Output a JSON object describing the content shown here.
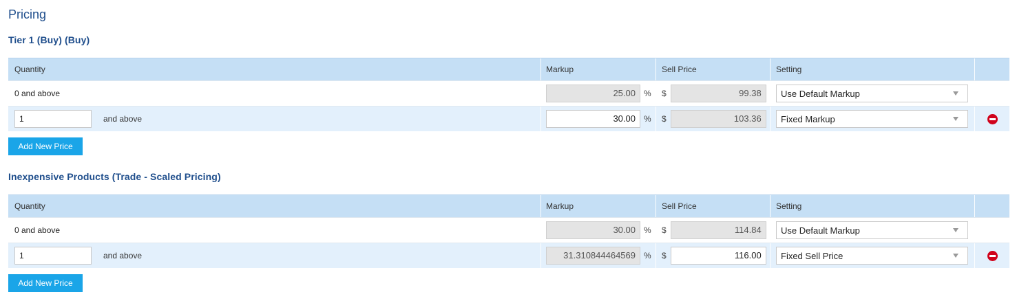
{
  "page": {
    "title": "Pricing"
  },
  "columns": {
    "quantity": "Quantity",
    "markup": "Markup",
    "sell_price": "Sell Price",
    "setting": "Setting"
  },
  "symbols": {
    "percent": "%",
    "dollar": "$"
  },
  "add_label": "Add New Price",
  "sections": [
    {
      "title": "Tier 1 (Buy) (Buy)",
      "rows": [
        {
          "quantity_text": "0 and above",
          "markup": "25.00",
          "sell_price": "99.38",
          "setting": "Use Default Markup"
        },
        {
          "quantity_value": "1",
          "and_above": "and above",
          "markup": "30.00",
          "sell_price": "103.36",
          "setting": "Fixed Markup"
        }
      ]
    },
    {
      "title": "Inexpensive Products (Trade - Scaled Pricing)",
      "rows": [
        {
          "quantity_text": "0 and above",
          "markup": "30.00",
          "sell_price": "114.84",
          "setting": "Use Default Markup"
        },
        {
          "quantity_value": "1",
          "and_above": "and above",
          "markup": "31.310844464569",
          "sell_price": "116.00",
          "setting": "Fixed Sell Price"
        }
      ]
    }
  ]
}
